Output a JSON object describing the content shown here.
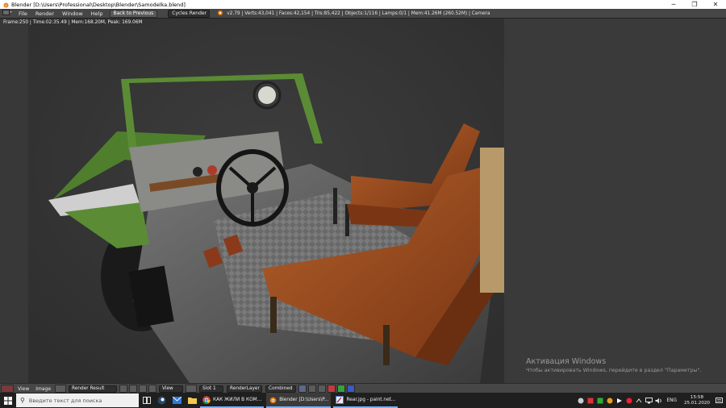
{
  "window": {
    "title": "Blender [D:\\Users\\Professional\\Desktop\\Blender\\Samodelka.blend]",
    "minimize": "─",
    "maximize": "❐",
    "close": "✕"
  },
  "menubar": {
    "items": [
      "File",
      "Render",
      "Window",
      "Help"
    ],
    "back_button": "Back to Previous",
    "render_engine": "Cycles Render",
    "stats": "v2.79 | Verts:43,041 | Faces:42,154 | Tris:85,422 | Objects:1/116 | Lamps:0/1 | Mem:41.26M (260.52M) | Camera"
  },
  "viewport": {
    "frame_info": "Frame:250 | Time:02:35.49 | Mem:168.20M, Peak: 169.06M"
  },
  "watermark": {
    "line1": "Активация Windows",
    "line2": "Чтобы активировать Windows, перейдите в раздел \"Параметры\"."
  },
  "image_header": {
    "view": "View",
    "image": "Image",
    "image_name": "Render Result",
    "view_menu": "View",
    "slot": "Slot 1",
    "layer": "RenderLayer",
    "pass": "Combined"
  },
  "taskbar": {
    "search_placeholder": "Введите текст для поиска",
    "apps": [
      {
        "label": "КАК ЖИЛИ В КОМ...",
        "icon": "chrome-icon"
      },
      {
        "label": "Blender [D:\\Users\\P...",
        "icon": "blender-icon"
      },
      {
        "label": "Rear.jpg - paint.net...",
        "icon": "paintnet-icon"
      }
    ],
    "language": "ENG",
    "time": "15:58",
    "date": "25.01.2020"
  },
  "colors": {
    "accent": "#7ab0ff",
    "blender_orange": "#e87d0d",
    "body_green": "#5b8c35",
    "seat_brown": "#9a4a1c"
  }
}
